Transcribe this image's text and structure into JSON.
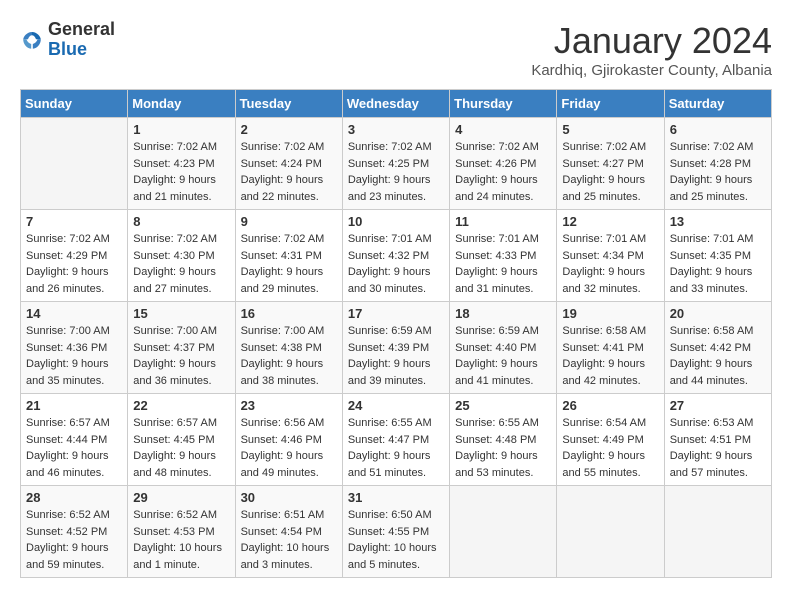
{
  "header": {
    "logo_general": "General",
    "logo_blue": "Blue",
    "title": "January 2024",
    "subtitle": "Kardhiq, Gjirokaster County, Albania"
  },
  "days_of_week": [
    "Sunday",
    "Monday",
    "Tuesday",
    "Wednesday",
    "Thursday",
    "Friday",
    "Saturday"
  ],
  "weeks": [
    [
      {
        "day": "",
        "sunrise": "",
        "sunset": "",
        "daylight": ""
      },
      {
        "day": "1",
        "sunrise": "Sunrise: 7:02 AM",
        "sunset": "Sunset: 4:23 PM",
        "daylight": "Daylight: 9 hours and 21 minutes."
      },
      {
        "day": "2",
        "sunrise": "Sunrise: 7:02 AM",
        "sunset": "Sunset: 4:24 PM",
        "daylight": "Daylight: 9 hours and 22 minutes."
      },
      {
        "day": "3",
        "sunrise": "Sunrise: 7:02 AM",
        "sunset": "Sunset: 4:25 PM",
        "daylight": "Daylight: 9 hours and 23 minutes."
      },
      {
        "day": "4",
        "sunrise": "Sunrise: 7:02 AM",
        "sunset": "Sunset: 4:26 PM",
        "daylight": "Daylight: 9 hours and 24 minutes."
      },
      {
        "day": "5",
        "sunrise": "Sunrise: 7:02 AM",
        "sunset": "Sunset: 4:27 PM",
        "daylight": "Daylight: 9 hours and 25 minutes."
      },
      {
        "day": "6",
        "sunrise": "Sunrise: 7:02 AM",
        "sunset": "Sunset: 4:28 PM",
        "daylight": "Daylight: 9 hours and 25 minutes."
      }
    ],
    [
      {
        "day": "7",
        "sunrise": "",
        "sunset": "",
        "daylight": ""
      },
      {
        "day": "8",
        "sunrise": "Sunrise: 7:02 AM",
        "sunset": "Sunset: 4:30 PM",
        "daylight": "Daylight: 9 hours and 27 minutes."
      },
      {
        "day": "9",
        "sunrise": "Sunrise: 7:02 AM",
        "sunset": "Sunset: 4:31 PM",
        "daylight": "Daylight: 9 hours and 29 minutes."
      },
      {
        "day": "10",
        "sunrise": "Sunrise: 7:01 AM",
        "sunset": "Sunset: 4:32 PM",
        "daylight": "Daylight: 9 hours and 30 minutes."
      },
      {
        "day": "11",
        "sunrise": "Sunrise: 7:01 AM",
        "sunset": "Sunset: 4:33 PM",
        "daylight": "Daylight: 9 hours and 31 minutes."
      },
      {
        "day": "12",
        "sunrise": "Sunrise: 7:01 AM",
        "sunset": "Sunset: 4:34 PM",
        "daylight": "Daylight: 9 hours and 32 minutes."
      },
      {
        "day": "13",
        "sunrise": "Sunrise: 7:01 AM",
        "sunset": "Sunset: 4:35 PM",
        "daylight": "Daylight: 9 hours and 33 minutes."
      }
    ],
    [
      {
        "day": "14",
        "sunrise": "",
        "sunset": "",
        "daylight": ""
      },
      {
        "day": "15",
        "sunrise": "Sunrise: 7:00 AM",
        "sunset": "Sunset: 4:37 PM",
        "daylight": "Daylight: 9 hours and 36 minutes."
      },
      {
        "day": "16",
        "sunrise": "Sunrise: 7:00 AM",
        "sunset": "Sunset: 4:38 PM",
        "daylight": "Daylight: 9 hours and 38 minutes."
      },
      {
        "day": "17",
        "sunrise": "Sunrise: 6:59 AM",
        "sunset": "Sunset: 4:39 PM",
        "daylight": "Daylight: 9 hours and 39 minutes."
      },
      {
        "day": "18",
        "sunrise": "Sunrise: 6:59 AM",
        "sunset": "Sunset: 4:40 PM",
        "daylight": "Daylight: 9 hours and 41 minutes."
      },
      {
        "day": "19",
        "sunrise": "Sunrise: 6:58 AM",
        "sunset": "Sunset: 4:41 PM",
        "daylight": "Daylight: 9 hours and 42 minutes."
      },
      {
        "day": "20",
        "sunrise": "Sunrise: 6:58 AM",
        "sunset": "Sunset: 4:42 PM",
        "daylight": "Daylight: 9 hours and 44 minutes."
      }
    ],
    [
      {
        "day": "21",
        "sunrise": "Sunrise: 6:57 AM",
        "sunset": "Sunset: 4:44 PM",
        "daylight": "Daylight: 9 hours and 46 minutes."
      },
      {
        "day": "22",
        "sunrise": "Sunrise: 6:57 AM",
        "sunset": "Sunset: 4:45 PM",
        "daylight": "Daylight: 9 hours and 48 minutes."
      },
      {
        "day": "23",
        "sunrise": "Sunrise: 6:56 AM",
        "sunset": "Sunset: 4:46 PM",
        "daylight": "Daylight: 9 hours and 49 minutes."
      },
      {
        "day": "24",
        "sunrise": "Sunrise: 6:55 AM",
        "sunset": "Sunset: 4:47 PM",
        "daylight": "Daylight: 9 hours and 51 minutes."
      },
      {
        "day": "25",
        "sunrise": "Sunrise: 6:55 AM",
        "sunset": "Sunset: 4:48 PM",
        "daylight": "Daylight: 9 hours and 53 minutes."
      },
      {
        "day": "26",
        "sunrise": "Sunrise: 6:54 AM",
        "sunset": "Sunset: 4:49 PM",
        "daylight": "Daylight: 9 hours and 55 minutes."
      },
      {
        "day": "27",
        "sunrise": "Sunrise: 6:53 AM",
        "sunset": "Sunset: 4:51 PM",
        "daylight": "Daylight: 9 hours and 57 minutes."
      }
    ],
    [
      {
        "day": "28",
        "sunrise": "Sunrise: 6:52 AM",
        "sunset": "Sunset: 4:52 PM",
        "daylight": "Daylight: 9 hours and 59 minutes."
      },
      {
        "day": "29",
        "sunrise": "Sunrise: 6:52 AM",
        "sunset": "Sunset: 4:53 PM",
        "daylight": "Daylight: 10 hours and 1 minute."
      },
      {
        "day": "30",
        "sunrise": "Sunrise: 6:51 AM",
        "sunset": "Sunset: 4:54 PM",
        "daylight": "Daylight: 10 hours and 3 minutes."
      },
      {
        "day": "31",
        "sunrise": "Sunrise: 6:50 AM",
        "sunset": "Sunset: 4:55 PM",
        "daylight": "Daylight: 10 hours and 5 minutes."
      },
      {
        "day": "",
        "sunrise": "",
        "sunset": "",
        "daylight": ""
      },
      {
        "day": "",
        "sunrise": "",
        "sunset": "",
        "daylight": ""
      },
      {
        "day": "",
        "sunrise": "",
        "sunset": "",
        "daylight": ""
      }
    ]
  ],
  "week1_sun": {
    "sunrise": "",
    "sunset": "",
    "daylight": ""
  },
  "week2_sun": {
    "sunrise": "Sunrise: 7:02 AM",
    "sunset": "Sunset: 4:29 PM",
    "daylight": "Daylight: 9 hours and 26 minutes."
  },
  "week3_sun": {
    "sunrise": "Sunrise: 7:00 AM",
    "sunset": "Sunset: 4:36 PM",
    "daylight": "Daylight: 9 hours and 35 minutes."
  }
}
